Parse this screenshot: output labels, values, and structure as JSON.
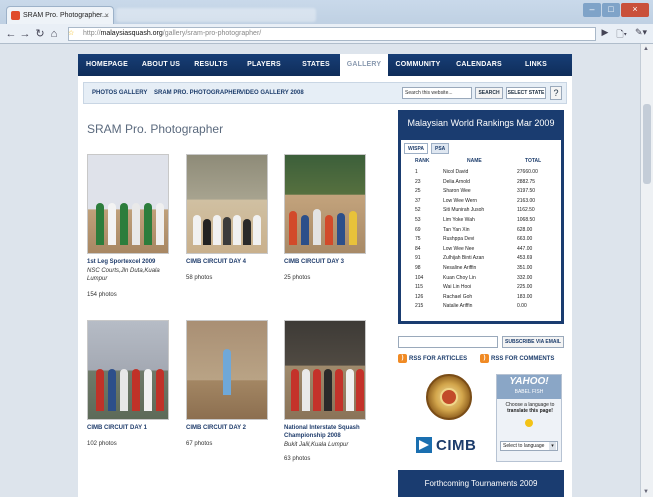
{
  "browser": {
    "tab_title": "SRAM Pro. Photographer...",
    "url_host": "malaysiasquash.org",
    "url_prefix": "http://",
    "url_path": "/gallery/sram-pro-photographer/"
  },
  "nav": {
    "items": [
      {
        "label": "HOMEPAGE"
      },
      {
        "label": "ABOUT US"
      },
      {
        "label": "RESULTS"
      },
      {
        "label": "PLAYERS"
      },
      {
        "label": "STATES"
      },
      {
        "label": "GALLERY"
      },
      {
        "label": "COMMUNITY"
      },
      {
        "label": "CALENDARS"
      },
      {
        "label": "LINKS"
      }
    ],
    "active": "GALLERY"
  },
  "subnav": {
    "items": [
      {
        "label": "PHOTOS GALLERY"
      },
      {
        "label": "SRAM PRO. PHOTOGRAPHER"
      },
      {
        "label": "VIDEO GALLERY 2008"
      }
    ],
    "search_placeholder": "Search this website...",
    "search_button": "SEARCH",
    "select_state": "SELECT STATE",
    "help": "?"
  },
  "gallery": {
    "title": "SRAM Pro. Photographer",
    "albums": [
      {
        "name": "1st Leg Sportexcel 2009",
        "location": "NSC Courts,Jln Duta,Kuala Lumpur",
        "count": "154 photos"
      },
      {
        "name": "CIMB CIRCUIT DAY 4",
        "location": "",
        "count": "58 photos"
      },
      {
        "name": "CIMB CIRCUIT DAY 3",
        "location": "",
        "count": "25 photos"
      },
      {
        "name": "CIMB CIRCUIT DAY 1",
        "location": "",
        "count": "102 photos"
      },
      {
        "name": "CIMB CIRCUIT DAY 2",
        "location": "",
        "count": "67 photos"
      },
      {
        "name": "National Interstate Squash Championship 2008",
        "location": "Bukit Jalil,Kuala Lumpur",
        "count": "63 photos"
      }
    ]
  },
  "rankings": {
    "title": "Malaysian World Rankings Mar 2009",
    "tabs": [
      "WISPA",
      "PSA"
    ],
    "headers": [
      "RANK",
      "NAME",
      "TOTAL"
    ],
    "rows": [
      {
        "rank": "1",
        "name": "Nicol David",
        "total": "27660.00"
      },
      {
        "rank": "23",
        "name": "Delia Arnold",
        "total": "2882.75"
      },
      {
        "rank": "25",
        "name": "Sharon Wee",
        "total": "3197.50"
      },
      {
        "rank": "37",
        "name": "Low Wee Wern",
        "total": "2163.00"
      },
      {
        "rank": "52",
        "name": "Siti Munirah Jusoh",
        "total": "1162.50"
      },
      {
        "rank": "53",
        "name": "Lim Yoke Wah",
        "total": "1068.50"
      },
      {
        "rank": "69",
        "name": "Tan Yan Xin",
        "total": "628.00"
      },
      {
        "rank": "75",
        "name": "Rushppa Devi",
        "total": "663.00"
      },
      {
        "rank": "84",
        "total": "447.00",
        "name": "Low Wee Nee"
      },
      {
        "rank": "91",
        "name": "Zulhijah Binti Azan",
        "total": "453.69"
      },
      {
        "rank": "98",
        "name": "Nesaline Ariffin",
        "total": "351.00"
      },
      {
        "rank": "104",
        "name": "Kuan Choy Lin",
        "total": "332.00"
      },
      {
        "rank": "115",
        "name": "Wai Lin Hooi",
        "total": "225.00"
      },
      {
        "rank": "126",
        "name": "Rachael Goh",
        "total": "183.00"
      },
      {
        "rank": "215",
        "name": "Natalie Ariffin",
        "total": "0.00"
      }
    ]
  },
  "subscribe": {
    "button": "SUBSCRIBE VIA EMAIL"
  },
  "rss": {
    "articles": "RSS FOR ARTICLES",
    "comments": "RSS FOR COMMENTS"
  },
  "sponsor": {
    "name": "CIMB"
  },
  "babelfish": {
    "brand": "YAHOO!",
    "sub": "BABEL FISH",
    "prompt": "Choose a language to",
    "prompt_strong": "translate this page!",
    "select": "Select to language"
  },
  "tournaments": {
    "title": "Forthcoming Tournaments 2009"
  },
  "colors": {
    "nav_bg": "#173e76",
    "accent": "#1d3d6c",
    "rss": "#f08a24"
  }
}
